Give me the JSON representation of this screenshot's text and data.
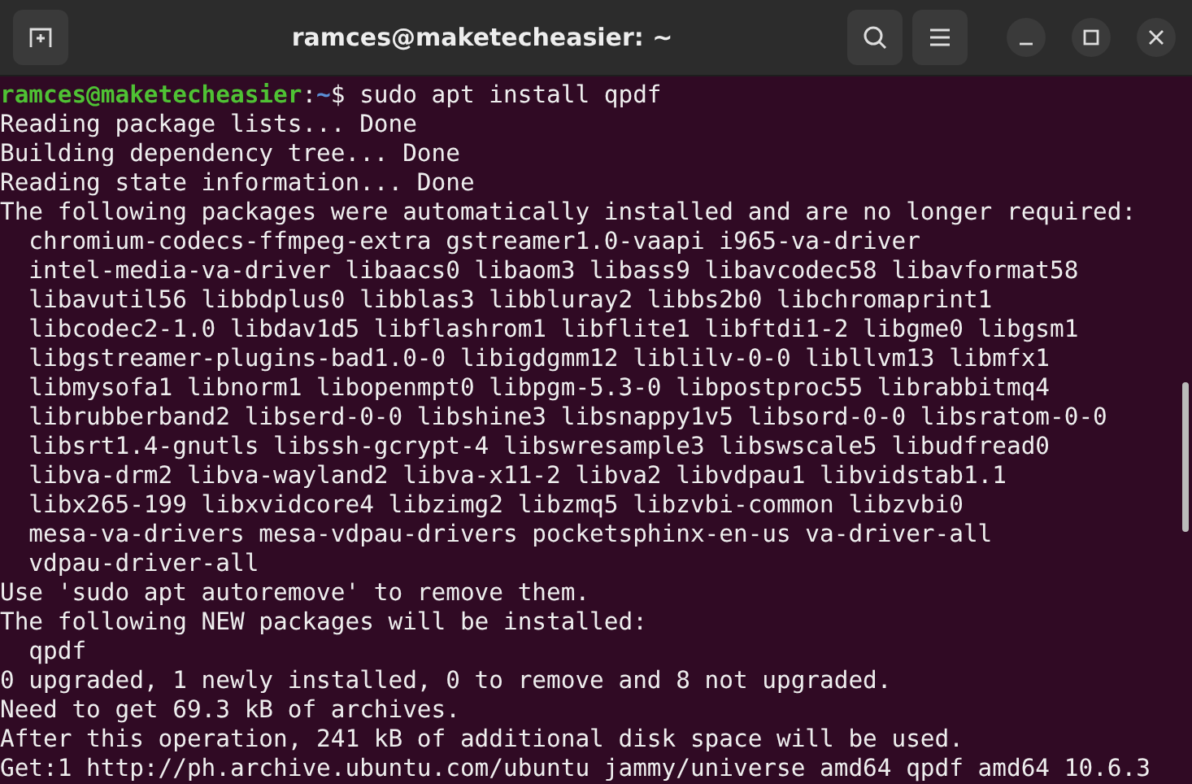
{
  "window": {
    "title": "ramces@maketecheasier: ~"
  },
  "prompt": {
    "user_host": "ramces@maketecheasier",
    "separator": ":",
    "path": "~",
    "symbol": "$",
    "command": " sudo apt install qpdf"
  },
  "output_lines": [
    "Reading package lists... Done",
    "Building dependency tree... Done",
    "Reading state information... Done",
    "The following packages were automatically installed and are no longer required:",
    "  chromium-codecs-ffmpeg-extra gstreamer1.0-vaapi i965-va-driver",
    "  intel-media-va-driver libaacs0 libaom3 libass9 libavcodec58 libavformat58",
    "  libavutil56 libbdplus0 libblas3 libbluray2 libbs2b0 libchromaprint1",
    "  libcodec2-1.0 libdav1d5 libflashrom1 libflite1 libftdi1-2 libgme0 libgsm1",
    "  libgstreamer-plugins-bad1.0-0 libigdgmm12 liblilv-0-0 libllvm13 libmfx1",
    "  libmysofa1 libnorm1 libopenmpt0 libpgm-5.3-0 libpostproc55 librabbitmq4",
    "  librubberband2 libserd-0-0 libshine3 libsnappy1v5 libsord-0-0 libsratom-0-0",
    "  libsrt1.4-gnutls libssh-gcrypt-4 libswresample3 libswscale5 libudfread0",
    "  libva-drm2 libva-wayland2 libva-x11-2 libva2 libvdpau1 libvidstab1.1",
    "  libx265-199 libxvidcore4 libzimg2 libzmq5 libzvbi-common libzvbi0",
    "  mesa-va-drivers mesa-vdpau-drivers pocketsphinx-en-us va-driver-all",
    "  vdpau-driver-all",
    "Use 'sudo apt autoremove' to remove them.",
    "The following NEW packages will be installed:",
    "  qpdf",
    "0 upgraded, 1 newly installed, 0 to remove and 8 not upgraded.",
    "Need to get 69.3 kB of archives.",
    "After this operation, 241 kB of additional disk space will be used.",
    "Get:1 http://ph.archive.ubuntu.com/ubuntu jammy/universe amd64 qpdf amd64 10.6.3"
  ]
}
